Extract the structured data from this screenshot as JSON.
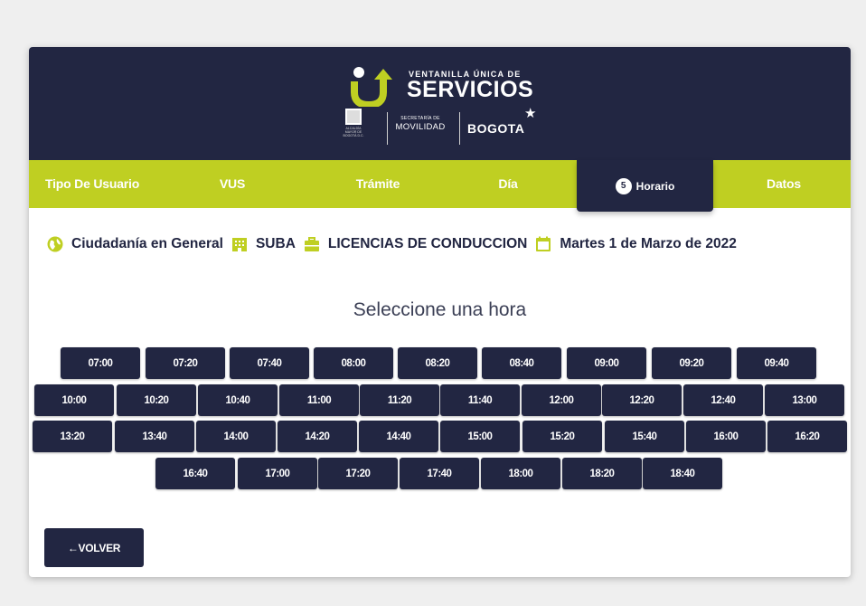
{
  "brand": {
    "title_small": "VENTANILLA ÚNICA DE",
    "title_main": "SERVICIOS",
    "seal_text": "ALCALDÍA MAYOR DE BOGOTÁ D.C.",
    "secretaria_small": "SECRETARÍA DE",
    "secretaria_main": "MOVILIDAD",
    "city": "BOGOTA",
    "accent": "#bfcf22",
    "navy": "#222642"
  },
  "tabs": [
    {
      "label": "Tipo De Usuario"
    },
    {
      "label": "VUS"
    },
    {
      "label": "Trámite"
    },
    {
      "label": "Día"
    },
    {
      "label": "Horario",
      "step": "5",
      "active": true
    },
    {
      "label": "Datos"
    }
  ],
  "summary": {
    "user_type": "Ciudadanía en General",
    "office": "SUBA",
    "procedure": "LICENCIAS DE CONDUCCION",
    "date": "Martes 1 de Marzo de 2022",
    "icons": [
      "globe-icon",
      "building-icon",
      "briefcase-icon",
      "calendar-icon"
    ]
  },
  "heading": "Seleccione una hora",
  "time_slots": {
    "row1": [
      "07:00",
      "07:20",
      "07:40",
      "08:00",
      "08:20",
      "08:40",
      "09:00",
      "09:20",
      "09:40"
    ],
    "row2": [
      "10:00",
      "10:20",
      "10:40",
      "11:00",
      "11:20",
      "11:40",
      "12:00",
      "12:20",
      "12:40",
      "13:00"
    ],
    "row3": [
      "13:20",
      "13:40",
      "14:00",
      "14:20",
      "14:40",
      "15:00",
      "15:20",
      "15:40",
      "16:00",
      "16:20"
    ],
    "row4": [
      "16:40",
      "17:00",
      "17:20",
      "17:40",
      "18:00",
      "18:20",
      "18:40"
    ]
  },
  "back_button": {
    "arrow": "←",
    "label": "VOLVER"
  }
}
